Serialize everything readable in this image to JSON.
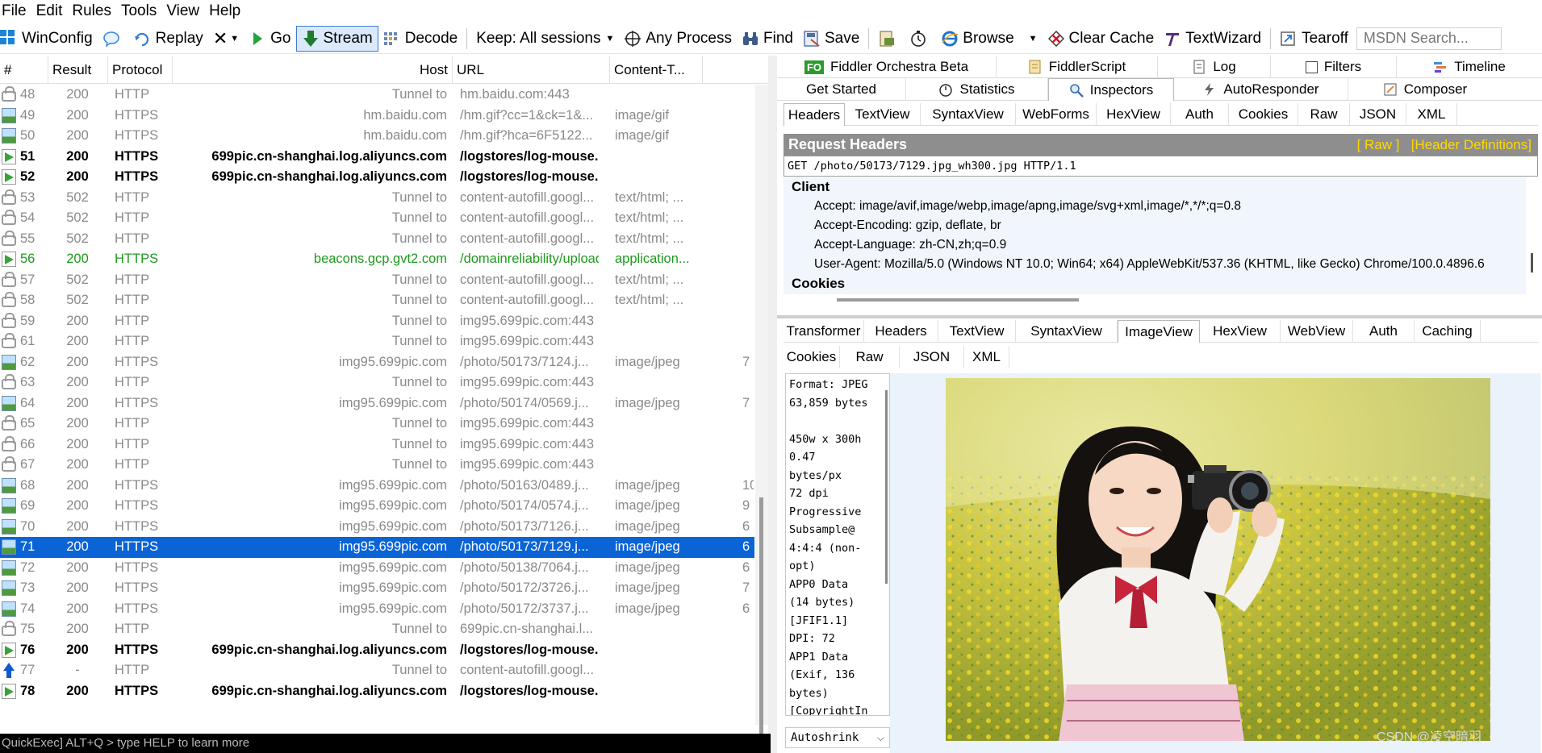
{
  "menu": [
    "File",
    "Edit",
    "Rules",
    "Tools",
    "View",
    "Help"
  ],
  "toolbar": {
    "winconfig": "WinConfig",
    "replay": "Replay",
    "go": "Go",
    "stream": "Stream",
    "decode": "Decode",
    "keep": "Keep: All sessions",
    "any_process": "Any Process",
    "find": "Find",
    "save": "Save",
    "browse": "Browse",
    "clear_cache": "Clear Cache",
    "textwizard": "TextWizard",
    "tearoff": "Tearoff",
    "msdn_search": "MSDN Search..."
  },
  "sessions": {
    "columns": [
      "#",
      "Result",
      "Protocol",
      "Host",
      "URL",
      "Content-T..."
    ],
    "rows": [
      {
        "num": "48",
        "result": "200",
        "protocol": "HTTP",
        "host": "Tunnel to",
        "url": "hm.baidu.com:443",
        "ctype": "",
        "extra": "",
        "style": "gray",
        "icon": "lock"
      },
      {
        "num": "49",
        "result": "200",
        "protocol": "HTTPS",
        "host": "hm.baidu.com",
        "url": "/hm.gif?cc=1&ck=1&...",
        "ctype": "image/gif",
        "extra": "",
        "style": "gray",
        "icon": "img"
      },
      {
        "num": "50",
        "result": "200",
        "protocol": "HTTPS",
        "host": "hm.baidu.com",
        "url": "/hm.gif?hca=6F5122...",
        "ctype": "image/gif",
        "extra": "",
        "style": "gray",
        "icon": "img"
      },
      {
        "num": "51",
        "result": "200",
        "protocol": "HTTPS",
        "host": "699pic.cn-shanghai.log.aliyuncs.com",
        "url": "/logstores/log-mouse...",
        "ctype": "",
        "extra": "",
        "style": "bold",
        "icon": "arr"
      },
      {
        "num": "52",
        "result": "200",
        "protocol": "HTTPS",
        "host": "699pic.cn-shanghai.log.aliyuncs.com",
        "url": "/logstores/log-mouse...",
        "ctype": "",
        "extra": "",
        "style": "bold",
        "icon": "arr"
      },
      {
        "num": "53",
        "result": "502",
        "protocol": "HTTP",
        "host": "Tunnel to",
        "url": "content-autofill.googl...",
        "ctype": "text/html; ...",
        "extra": "",
        "style": "gray",
        "icon": "lock"
      },
      {
        "num": "54",
        "result": "502",
        "protocol": "HTTP",
        "host": "Tunnel to",
        "url": "content-autofill.googl...",
        "ctype": "text/html; ...",
        "extra": "",
        "style": "gray",
        "icon": "lock"
      },
      {
        "num": "55",
        "result": "502",
        "protocol": "HTTP",
        "host": "Tunnel to",
        "url": "content-autofill.googl...",
        "ctype": "text/html; ...",
        "extra": "",
        "style": "gray",
        "icon": "lock"
      },
      {
        "num": "56",
        "result": "200",
        "protocol": "HTTPS",
        "host": "beacons.gcp.gvt2.com",
        "url": "/domainreliability/upload",
        "ctype": "application...",
        "extra": "",
        "style": "green",
        "icon": "arr"
      },
      {
        "num": "57",
        "result": "502",
        "protocol": "HTTP",
        "host": "Tunnel to",
        "url": "content-autofill.googl...",
        "ctype": "text/html; ...",
        "extra": "",
        "style": "gray",
        "icon": "lock"
      },
      {
        "num": "58",
        "result": "502",
        "protocol": "HTTP",
        "host": "Tunnel to",
        "url": "content-autofill.googl...",
        "ctype": "text/html; ...",
        "extra": "",
        "style": "gray",
        "icon": "lock"
      },
      {
        "num": "59",
        "result": "200",
        "protocol": "HTTP",
        "host": "Tunnel to",
        "url": "img95.699pic.com:443",
        "ctype": "",
        "extra": "",
        "style": "gray",
        "icon": "lock"
      },
      {
        "num": "61",
        "result": "200",
        "protocol": "HTTP",
        "host": "Tunnel to",
        "url": "img95.699pic.com:443",
        "ctype": "",
        "extra": "",
        "style": "gray",
        "icon": "lock"
      },
      {
        "num": "62",
        "result": "200",
        "protocol": "HTTPS",
        "host": "img95.699pic.com",
        "url": "/photo/50173/7124.j...",
        "ctype": "image/jpeg",
        "extra": "7",
        "style": "gray",
        "icon": "img"
      },
      {
        "num": "63",
        "result": "200",
        "protocol": "HTTP",
        "host": "Tunnel to",
        "url": "img95.699pic.com:443",
        "ctype": "",
        "extra": "",
        "style": "gray",
        "icon": "lock"
      },
      {
        "num": "64",
        "result": "200",
        "protocol": "HTTPS",
        "host": "img95.699pic.com",
        "url": "/photo/50174/0569.j...",
        "ctype": "image/jpeg",
        "extra": "7",
        "style": "gray",
        "icon": "img"
      },
      {
        "num": "65",
        "result": "200",
        "protocol": "HTTP",
        "host": "Tunnel to",
        "url": "img95.699pic.com:443",
        "ctype": "",
        "extra": "",
        "style": "gray",
        "icon": "lock"
      },
      {
        "num": "66",
        "result": "200",
        "protocol": "HTTP",
        "host": "Tunnel to",
        "url": "img95.699pic.com:443",
        "ctype": "",
        "extra": "",
        "style": "gray",
        "icon": "lock"
      },
      {
        "num": "67",
        "result": "200",
        "protocol": "HTTP",
        "host": "Tunnel to",
        "url": "img95.699pic.com:443",
        "ctype": "",
        "extra": "",
        "style": "gray",
        "icon": "lock"
      },
      {
        "num": "68",
        "result": "200",
        "protocol": "HTTPS",
        "host": "img95.699pic.com",
        "url": "/photo/50163/0489.j...",
        "ctype": "image/jpeg",
        "extra": "10",
        "style": "gray",
        "icon": "img"
      },
      {
        "num": "69",
        "result": "200",
        "protocol": "HTTPS",
        "host": "img95.699pic.com",
        "url": "/photo/50174/0574.j...",
        "ctype": "image/jpeg",
        "extra": "9",
        "style": "gray",
        "icon": "img"
      },
      {
        "num": "70",
        "result": "200",
        "protocol": "HTTPS",
        "host": "img95.699pic.com",
        "url": "/photo/50173/7126.j...",
        "ctype": "image/jpeg",
        "extra": "6",
        "style": "gray",
        "icon": "img"
      },
      {
        "num": "71",
        "result": "200",
        "protocol": "HTTPS",
        "host": "img95.699pic.com",
        "url": "/photo/50173/7129.j...",
        "ctype": "image/jpeg",
        "extra": "6",
        "style": "sel",
        "icon": "img"
      },
      {
        "num": "72",
        "result": "200",
        "protocol": "HTTPS",
        "host": "img95.699pic.com",
        "url": "/photo/50138/7064.j...",
        "ctype": "image/jpeg",
        "extra": "6",
        "style": "gray",
        "icon": "img"
      },
      {
        "num": "73",
        "result": "200",
        "protocol": "HTTPS",
        "host": "img95.699pic.com",
        "url": "/photo/50172/3726.j...",
        "ctype": "image/jpeg",
        "extra": "7",
        "style": "gray",
        "icon": "img"
      },
      {
        "num": "74",
        "result": "200",
        "protocol": "HTTPS",
        "host": "img95.699pic.com",
        "url": "/photo/50172/3737.j...",
        "ctype": "image/jpeg",
        "extra": "6",
        "style": "gray",
        "icon": "img"
      },
      {
        "num": "75",
        "result": "200",
        "protocol": "HTTP",
        "host": "Tunnel to",
        "url": "699pic.cn-shanghai.l...",
        "ctype": "",
        "extra": "",
        "style": "gray",
        "icon": "lock"
      },
      {
        "num": "76",
        "result": "200",
        "protocol": "HTTPS",
        "host": "699pic.cn-shanghai.log.aliyuncs.com",
        "url": "/logstores/log-mouse...",
        "ctype": "",
        "extra": "",
        "style": "bold",
        "icon": "arr"
      },
      {
        "num": "77",
        "result": "-",
        "protocol": "HTTP",
        "host": "Tunnel to",
        "url": "content-autofill.googl...",
        "ctype": "",
        "extra": "",
        "style": "gray",
        "icon": "up"
      },
      {
        "num": "78",
        "result": "200",
        "protocol": "HTTPS",
        "host": "699pic.cn-shanghai.log.aliyuncs.com",
        "url": "/logstores/log-mouse...",
        "ctype": "",
        "extra": "",
        "style": "bold",
        "icon": "arr"
      }
    ]
  },
  "quickexec": "QuickExec] ALT+Q > type HELP to learn more",
  "top_tabs_row1": [
    "Fiddler Orchestra Beta",
    "FiddlerScript",
    "Log",
    "Filters",
    "Timeline"
  ],
  "fo_badge": "FO",
  "top_tabs_row2": [
    "Get Started",
    "Statistics",
    "Inspectors",
    "AutoResponder",
    "Composer"
  ],
  "request_tabs": [
    "Headers",
    "TextView",
    "SyntaxView",
    "WebForms",
    "HexView",
    "Auth",
    "Cookies",
    "Raw",
    "JSON",
    "XML"
  ],
  "request_headers": {
    "title": "Request Headers",
    "raw_link": "[ Raw ]",
    "defs_link": "[Header Definitions]",
    "request_line": "GET /photo/50173/7129.jpg_wh300.jpg HTTP/1.1",
    "group_client": "Client",
    "lines": [
      "Accept: image/avif,image/webp,image/apng,image/svg+xml,image/*,*/*;q=0.8",
      "Accept-Encoding: gzip, deflate, br",
      "Accept-Language: zh-CN,zh;q=0.9",
      "User-Agent: Mozilla/5.0 (Windows NT 10.0; Win64; x64) AppleWebKit/537.36 (KHTML, like Gecko) Chrome/100.0.4896.6"
    ],
    "group_cookies": "Cookies"
  },
  "response_tabs_row1": [
    "Transformer",
    "Headers",
    "TextView",
    "SyntaxView",
    "ImageView",
    "HexView",
    "WebView",
    "Auth",
    "Caching"
  ],
  "response_tabs_row2": [
    "Cookies",
    "Raw",
    "JSON",
    "XML"
  ],
  "image_info": "Format: JPEG\n63,859 bytes\n\n450w x 300h\n0.47\nbytes/px\n72 dpi\nProgressive\nSubsample@\n4:4:4 (non-\nopt)\nAPP0 Data\n(14 bytes)\n[JFIF1.1]\nDPI: 72\nAPP1 Data\n(Exif, 136\nbytes)\n[CopyrightIn",
  "autoshrink": "Autoshrink",
  "watermark": "CSDN @凌空暗羽"
}
